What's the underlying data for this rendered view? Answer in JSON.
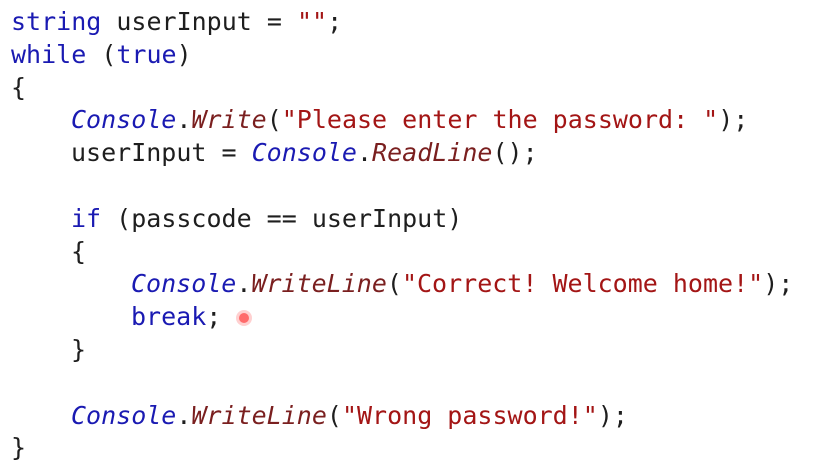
{
  "code": {
    "l1": {
      "kw": "string",
      "text": " userInput = ",
      "str": "\"\"",
      "end": ";"
    },
    "l2": {
      "kw": "while",
      "open": " (",
      "kw2": "true",
      "close": ")"
    },
    "l3": {
      "brace": "{"
    },
    "l4": {
      "type": "Console",
      "dot": ".",
      "meth": "Write",
      "open": "(",
      "str": "\"Please enter the password: \"",
      "close": ");"
    },
    "l5": {
      "text": "userInput = ",
      "type": "Console",
      "dot": ".",
      "meth": "ReadLine",
      "close": "();"
    },
    "l6": {},
    "l7": {
      "kw": "if",
      "text": " (passcode == userInput)"
    },
    "l8": {
      "brace": "{"
    },
    "l9": {
      "type": "Console",
      "dot": ".",
      "meth": "WriteLine",
      "open": "(",
      "str": "\"Correct! Welcome home!\"",
      "close": ");"
    },
    "l10": {
      "kw": "break",
      "end": ";"
    },
    "l11": {
      "brace": "}"
    },
    "l12": {},
    "l13": {
      "type": "Console",
      "dot": ".",
      "meth": "WriteLine",
      "open": "(",
      "str": "\"Wrong password!\"",
      "close": ");"
    },
    "l14": {
      "brace": "}"
    }
  },
  "colors": {
    "keyword": "#1a1ab2",
    "type": "#1a1ab2",
    "method": "#7a1f1f",
    "string": "#a31515",
    "text": "#1e1e1e",
    "background": "#ffffff",
    "cursor": "#ff6b6b"
  }
}
